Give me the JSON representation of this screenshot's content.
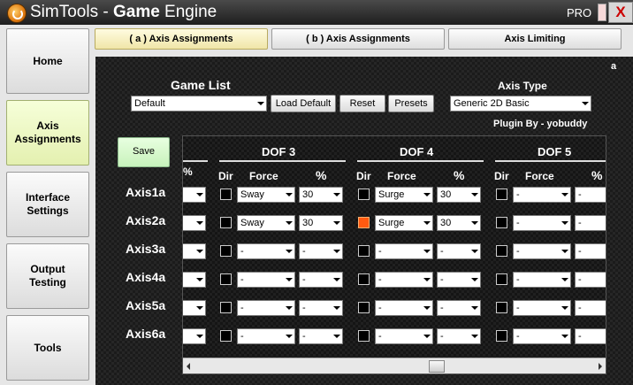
{
  "window": {
    "title_prefix": "SimTools - ",
    "title_bold": "Game",
    "title_suffix": " Engine",
    "edition": "PRO",
    "close_glyph": "X"
  },
  "sidebar": {
    "items": [
      {
        "label": "Home",
        "active": false
      },
      {
        "label": "Axis Assignments",
        "active": true
      },
      {
        "label": "Interface Settings",
        "active": false
      },
      {
        "label": "Output Testing",
        "active": false
      },
      {
        "label": "Tools",
        "active": false
      }
    ]
  },
  "tabs": [
    {
      "label": "( a ) Axis Assignments",
      "active": true
    },
    {
      "label": "( b ) Axis Assignments",
      "active": false
    },
    {
      "label": "Axis Limiting",
      "active": false
    }
  ],
  "panel": {
    "corner_letter": "a",
    "game_list_label": "Game List",
    "game_list_value": "Default",
    "load_default_label": "Load Default",
    "reset_label": "Reset",
    "presets_label": "Presets",
    "axis_type_label": "Axis Type",
    "axis_type_value": "Generic 2D Basic",
    "plugin_by": "Plugin By - yobuddy",
    "save_label": "Save"
  },
  "grid": {
    "dof_titles": [
      "DOF 3",
      "DOF 4",
      "DOF 5"
    ],
    "partial_percent_header": "%",
    "col_headers": {
      "dir": "Dir",
      "force": "Force",
      "percent": "%"
    },
    "axis_labels": [
      "Axis1a",
      "Axis2a",
      "Axis3a",
      "Axis4a",
      "Axis5a",
      "Axis6a"
    ],
    "dof3_rows": [
      {
        "dir": false,
        "force": "Sway",
        "percent": "30"
      },
      {
        "dir": false,
        "force": "Sway",
        "percent": "30"
      },
      {
        "dir": false,
        "force": "-",
        "percent": "-"
      },
      {
        "dir": false,
        "force": "-",
        "percent": "-"
      },
      {
        "dir": false,
        "force": "-",
        "percent": "-"
      },
      {
        "dir": false,
        "force": "-",
        "percent": "-"
      }
    ],
    "dof4_rows": [
      {
        "dir": false,
        "force": "Surge",
        "percent": "30"
      },
      {
        "dir": true,
        "force": "Surge",
        "percent": "30"
      },
      {
        "dir": false,
        "force": "-",
        "percent": "-"
      },
      {
        "dir": false,
        "force": "-",
        "percent": "-"
      },
      {
        "dir": false,
        "force": "-",
        "percent": "-"
      },
      {
        "dir": false,
        "force": "-",
        "percent": "-"
      }
    ],
    "dof5_rows": [
      {
        "dir": false,
        "force": "-",
        "percent": "-"
      },
      {
        "dir": false,
        "force": "-",
        "percent": "-"
      },
      {
        "dir": false,
        "force": "-",
        "percent": "-"
      },
      {
        "dir": false,
        "force": "-",
        "percent": "-"
      },
      {
        "dir": false,
        "force": "-",
        "percent": "-"
      },
      {
        "dir": false,
        "force": "-",
        "percent": "-"
      }
    ]
  },
  "colors": {
    "dir_checked": "#ff5a10",
    "save_button": "#c7f2bb",
    "active_tab": "#f0e6a8",
    "active_sidebar": "#e4f0b0"
  }
}
